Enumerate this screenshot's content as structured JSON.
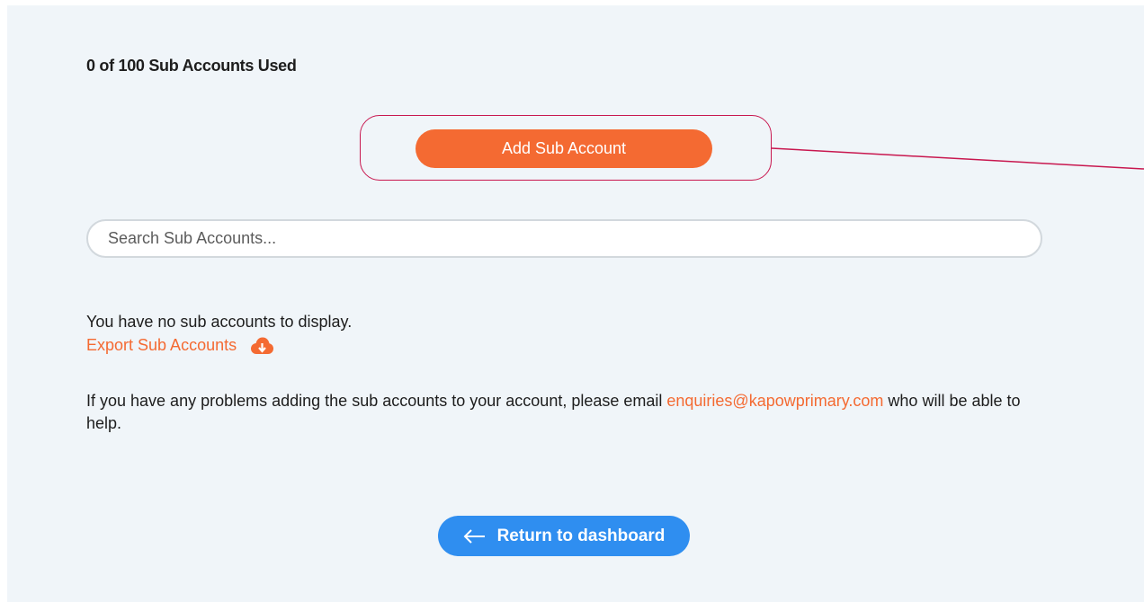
{
  "usage": {
    "text": "0 of 100 Sub Accounts Used"
  },
  "actions": {
    "add_label": "Add Sub Account"
  },
  "search": {
    "placeholder": "Search Sub Accounts...",
    "value": ""
  },
  "list": {
    "empty_message": "You have no sub accounts to display."
  },
  "export": {
    "label": "Export Sub Accounts",
    "icon": "cloud-download-icon"
  },
  "help": {
    "text_before": "If you have any problems adding the sub accounts to your account, please email ",
    "email": "enquiries@kapowprimary.com",
    "text_after": " who will be able to help."
  },
  "navigation": {
    "return_label": "Return to dashboard",
    "return_icon": "arrow-left-icon"
  },
  "colors": {
    "accent_orange": "#f46a32",
    "primary_blue": "#2f8ef0",
    "annotation": "#c8174f",
    "background": "#f0f5f9"
  }
}
